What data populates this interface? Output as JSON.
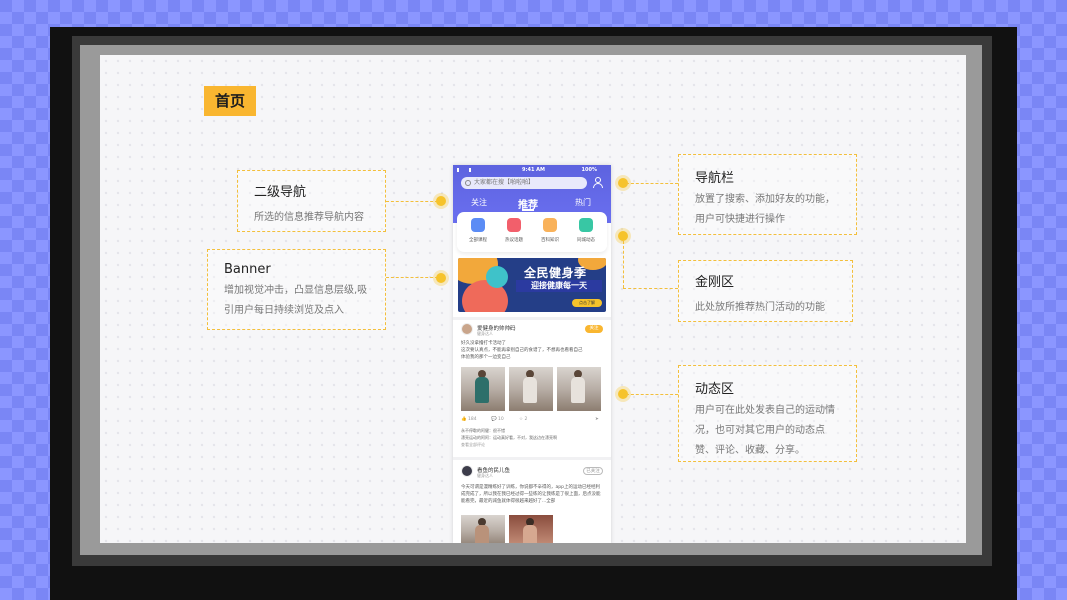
{
  "page_tag": "首页",
  "annotations": {
    "secondary_nav": {
      "title": "二级导航",
      "desc": "所选的信息推荐导航内容"
    },
    "banner": {
      "title": "Banner",
      "desc": "增加视觉冲击，凸显信息层级,吸引用户每日持续浏览及点入"
    },
    "navbar": {
      "title": "导航栏",
      "desc": "放置了搜索、添加好友的功能，用户可快捷进行操作"
    },
    "kingkong": {
      "title": "金刚区",
      "desc": "此处放所推荐热门活动的功能"
    },
    "feed": {
      "title": "动态区",
      "desc": "用户可在此处发表自己的运动情况，也可对其它用户的动态点赞、评论、收藏、分享。"
    }
  },
  "phone": {
    "status": {
      "time": "9:41 AM",
      "battery": "100%"
    },
    "search_placeholder": "大家都在搜【啪啦啪】",
    "tabs": [
      "关注",
      "推荐",
      "热门"
    ],
    "kingkong_items": [
      {
        "label": "全部课程",
        "color": "#5b8cf5"
      },
      {
        "label": "热议话题",
        "color": "#f25f6b"
      },
      {
        "label": "百科知识",
        "color": "#f9b25a"
      },
      {
        "label": "同城动态",
        "color": "#38c7a4"
      }
    ],
    "banner": {
      "title": "全民健身季",
      "subtitle": "迎接健康每一天",
      "button": "点击了解"
    },
    "posts": [
      {
        "name": "爱健身的帅帅码",
        "sub": "健身达人",
        "follow": "关注",
        "text": "好久没拿撸打卡活动了\n这次要认真点，不能再拿别自己的食谱了，不想再也看看自己\n体验我的那个一边变自己",
        "likes": "184",
        "comments_count": "10",
        "stars": "2",
        "comment_lines": [
          "永不停歇的阿健：很不错",
          "漂亮运动的阿阿：运动真好看，不对，我这边在漂亮啊",
          "查看全部评论"
        ]
      },
      {
        "name": "看鱼的民儿鱼",
        "sub": "健身达人",
        "follow": "已关注",
        "text": "今天可谓是漫精练好了训练，你说都不辛得的，app上的运动已经经利成完成了，所以我在我已经过得一些练的让我练是了很上面，后点没能能看完，最近的减鱼就体得很越来越好了...全部"
      }
    ]
  }
}
